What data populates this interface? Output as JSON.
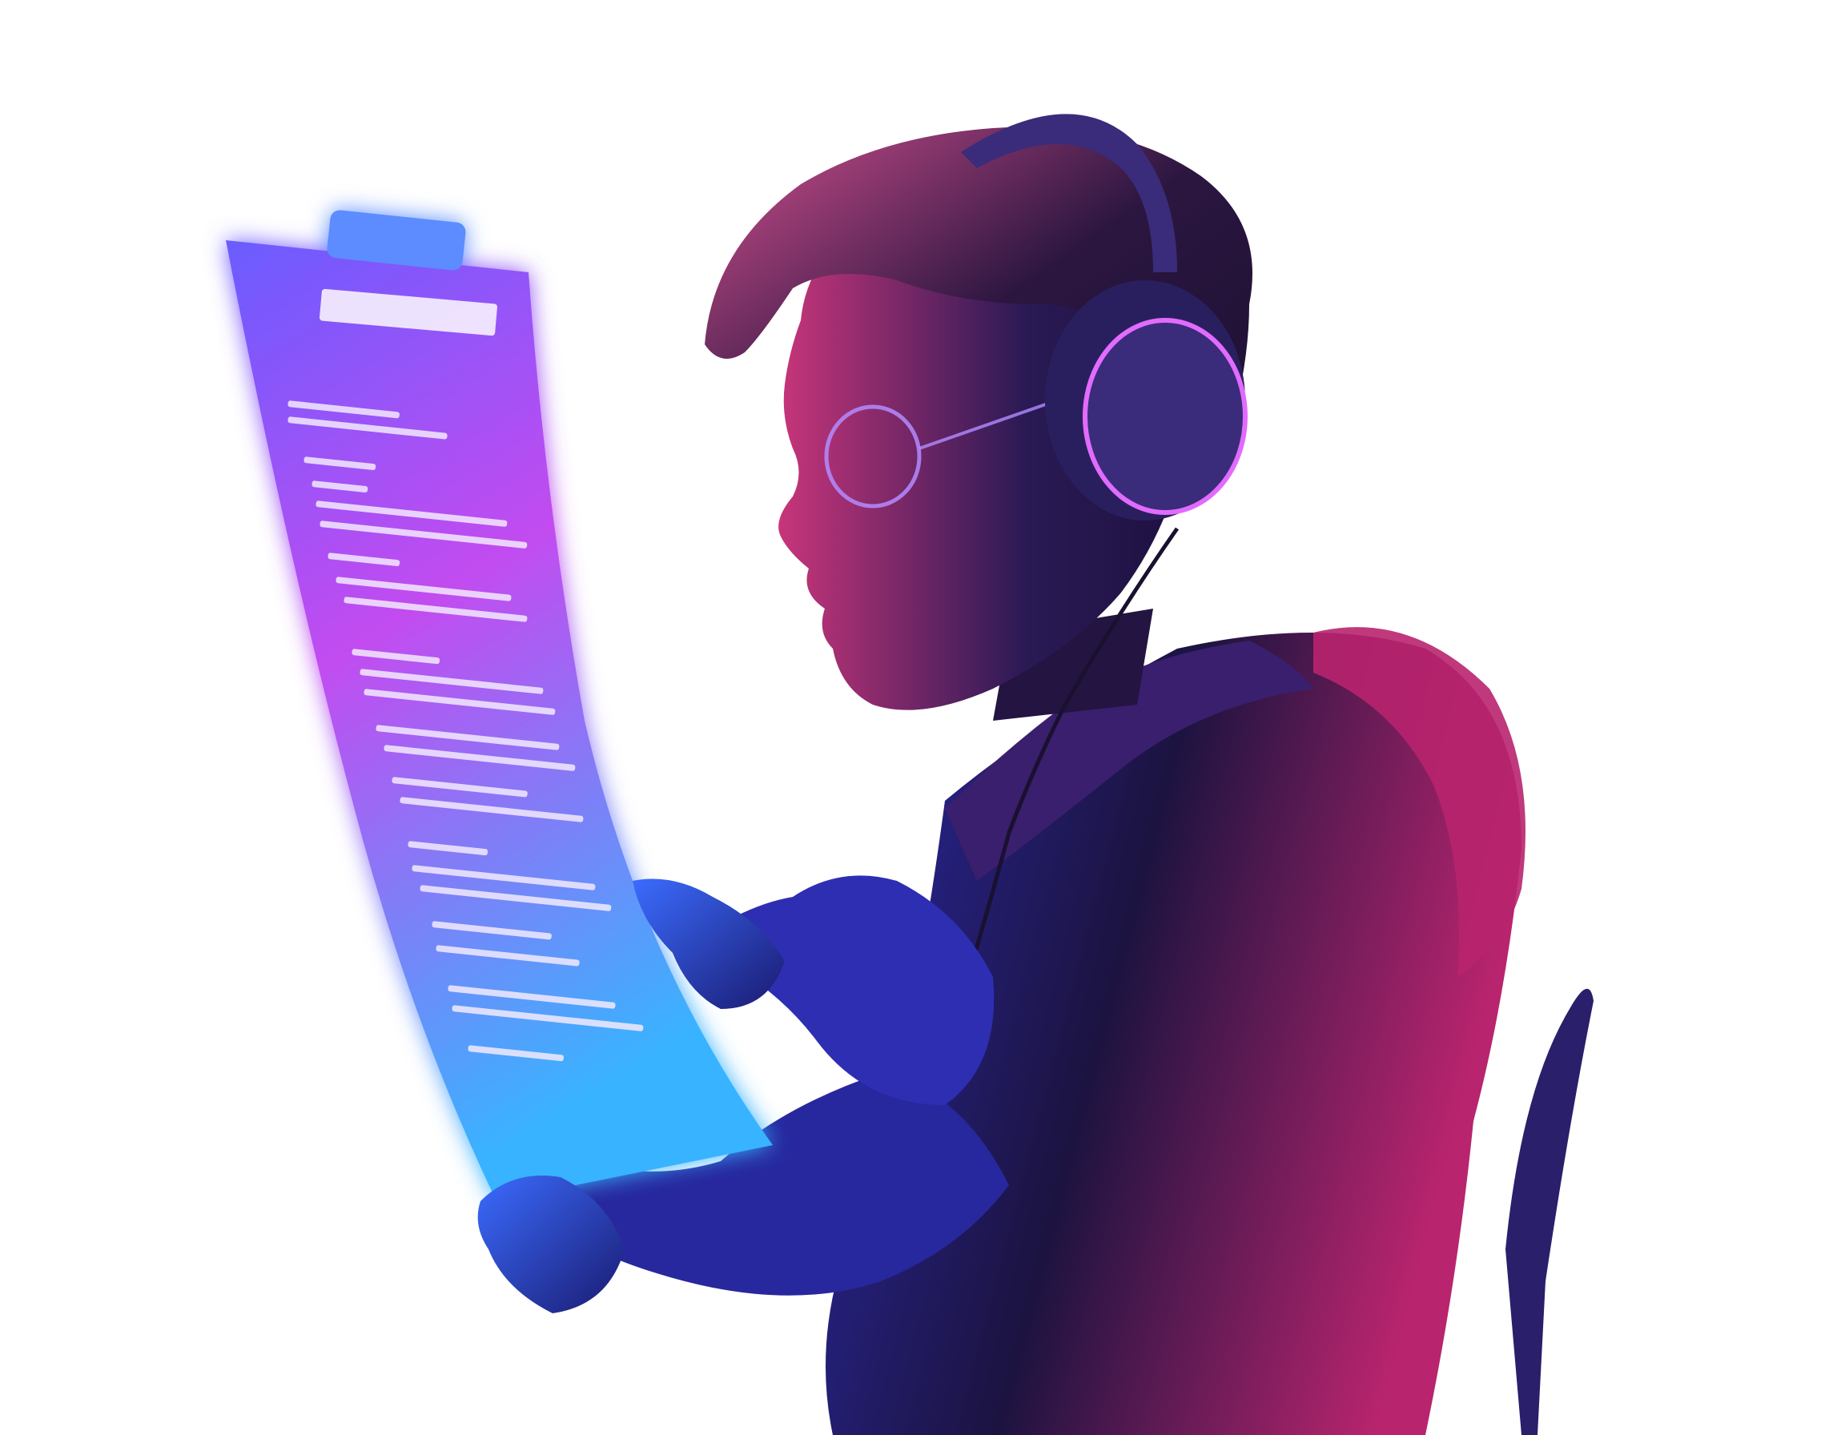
{
  "scene": {
    "background": "#ffffff",
    "palette": {
      "panel_top": "#6a5cff",
      "panel_mid": "#c24cf0",
      "panel_bottom": "#39b3ff",
      "panel_glow": "#8f7bff",
      "text_line": "#f3eaff",
      "skin_shadow": "#2a1a55",
      "skin_light": "#c8357a",
      "jacket_dark": "#1c1340",
      "jacket_blue": "#2a2aa8",
      "jacket_magenta": "#b8246e",
      "headphone": "#3a2c7a",
      "headphone_rim": "#e26bff",
      "chair": "#2a1f6a",
      "hair": "#2b1640",
      "hair_light": "#d4508f"
    },
    "icons": {
      "panel_clip": "clipboard-clip-icon",
      "headphones": "headphones-icon",
      "glasses": "glasses-icon"
    }
  }
}
